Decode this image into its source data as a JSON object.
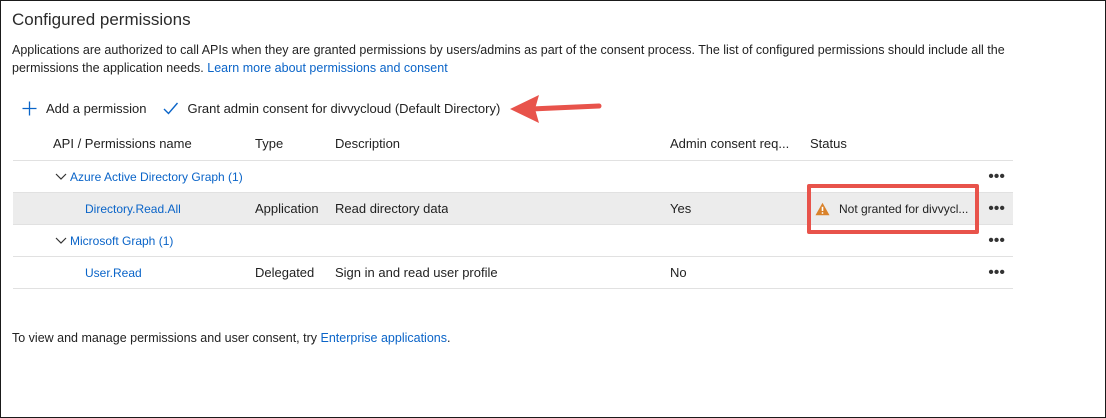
{
  "section": {
    "title": "Configured permissions",
    "description": "Applications are authorized to call APIs when they are granted permissions by users/admins as part of the consent process. The list of configured permissions should include all the permissions the application needs.",
    "learn_more_link": "Learn more about permissions and consent"
  },
  "toolbar": {
    "add_label": "Add a permission",
    "grant_label": "Grant admin consent for divvycloud (Default Directory)"
  },
  "table": {
    "headers": {
      "api": "API / Permissions name",
      "type": "Type",
      "description": "Description",
      "admin": "Admin consent req...",
      "status": "Status"
    },
    "groups": [
      {
        "name": "Azure Active Directory Graph (1)",
        "rows": [
          {
            "name": "Directory.Read.All",
            "type": "Application",
            "description": "Read directory data",
            "admin": "Yes",
            "status": "Not granted for divvycl..."
          }
        ]
      },
      {
        "name": "Microsoft Graph (1)",
        "rows": [
          {
            "name": "User.Read",
            "type": "Delegated",
            "description": "Sign in and read user profile",
            "admin": "No",
            "status": ""
          }
        ]
      }
    ],
    "more_glyph": "•••"
  },
  "footer": {
    "text": "To view and manage permissions and user consent, try",
    "link": "Enterprise applications",
    "suffix": "."
  },
  "colors": {
    "link": "#0a64c8",
    "annotation": "#e8534b",
    "warning": "#d9822b",
    "selected_row": "#ececec"
  },
  "icons": {
    "add": "plus-icon",
    "grant": "checkmark-icon",
    "group": "chevron-down-icon",
    "status": "warning-icon",
    "more": "more-icon"
  }
}
